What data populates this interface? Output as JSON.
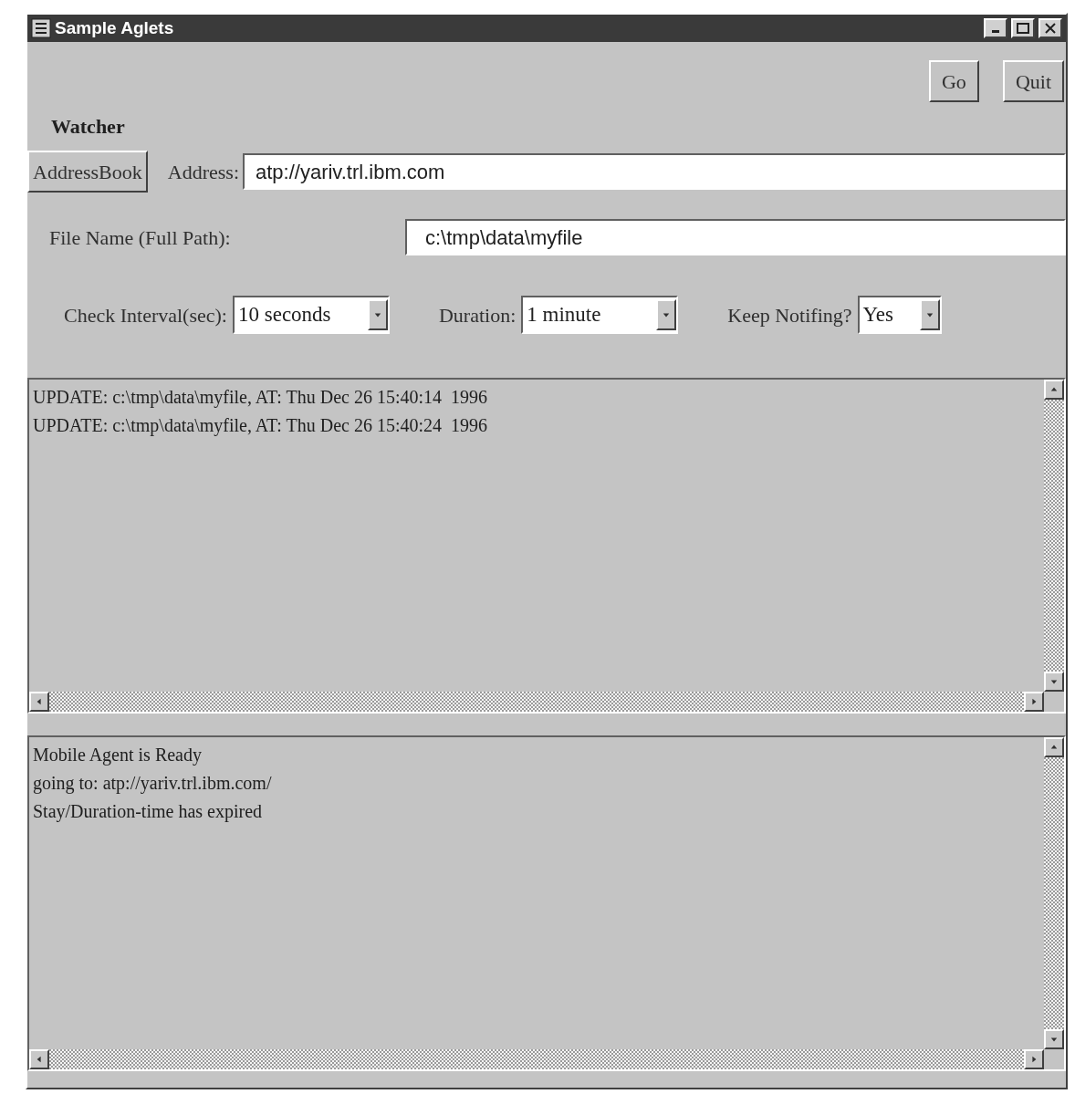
{
  "window": {
    "title": "Sample Aglets"
  },
  "buttons": [
    "Go",
    "Quit"
  ],
  "section_title": "Watcher",
  "address_book_button": "AddressBook",
  "address": {
    "label": "Address:",
    "value": "atp://yariv.trl.ibm.com"
  },
  "file_name": {
    "label": "File Name (Full Path):",
    "value": "c:\\tmp\\data\\myfile"
  },
  "dropdowns": [
    {
      "label": "Check Interval(sec):",
      "value": "10 seconds"
    },
    {
      "label": "Duration:",
      "value": "1 minute"
    },
    {
      "label": "Keep Notifing?",
      "value": "Yes"
    }
  ],
  "update_log": [
    "UPDATE: c:\\tmp\\data\\myfile, AT: Thu Dec 26 15:40:14  1996",
    "UPDATE: c:\\tmp\\data\\myfile, AT: Thu Dec 26 15:40:24  1996"
  ],
  "status_log": [
    "Mobile Agent is Ready",
    "going to: atp://yariv.trl.ibm.com/",
    "Stay/Duration-time has expired"
  ]
}
